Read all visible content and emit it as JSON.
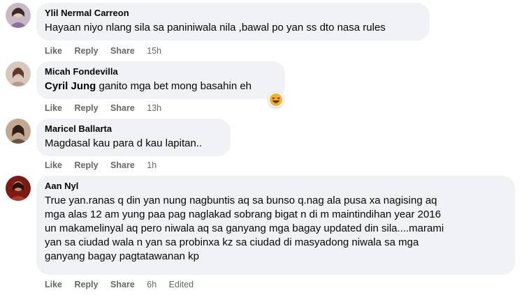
{
  "comments": [
    {
      "author": "Ylil Nermal Carreon",
      "text": "Hayaan niyo nlang sila sa paniniwala nila ,bawal po yan ss dto nasa rules",
      "like": "Like",
      "reply": "Reply",
      "share": "Share",
      "time": "15h"
    },
    {
      "author": "Micah Fondevilla",
      "mention": "Cyril Jung",
      "text": "ganito mga bet mong basahin eh",
      "like": "Like",
      "reply": "Reply",
      "share": "Share",
      "time": "13h",
      "reaction": "haha-reaction-icon"
    },
    {
      "author": "Maricel Ballarta",
      "text": "Magdasal kau para d kau lapitan..",
      "like": "Like",
      "reply": "Reply",
      "share": "Share",
      "time": "1h"
    },
    {
      "author": "Aan Nyl",
      "text_lines": [
        "True yan.ranas q din yan nung nagbuntis aq sa bunso q.nag ala pusa xa nagising aq",
        "mga alas 12 am yung paa pag naglakad sobrang bigat n di m maintindihan year 2016",
        "un makamelinyal aq pero niwala aq sa ganyang mga bagay updated din sila....marami",
        "yan sa ciudad wala n yan sa probinxa kz sa ciudad di masyadong niwala sa mga",
        "ganyang bagay pagtatawanan kp"
      ],
      "like": "Like",
      "reply": "Reply",
      "share": "Share",
      "time": "6h",
      "edited": "Edited"
    }
  ],
  "colors": {
    "bubble": "#f0f2f5",
    "meta_text": "#65676b",
    "body_text": "#050505",
    "haha": "#f7b125"
  }
}
